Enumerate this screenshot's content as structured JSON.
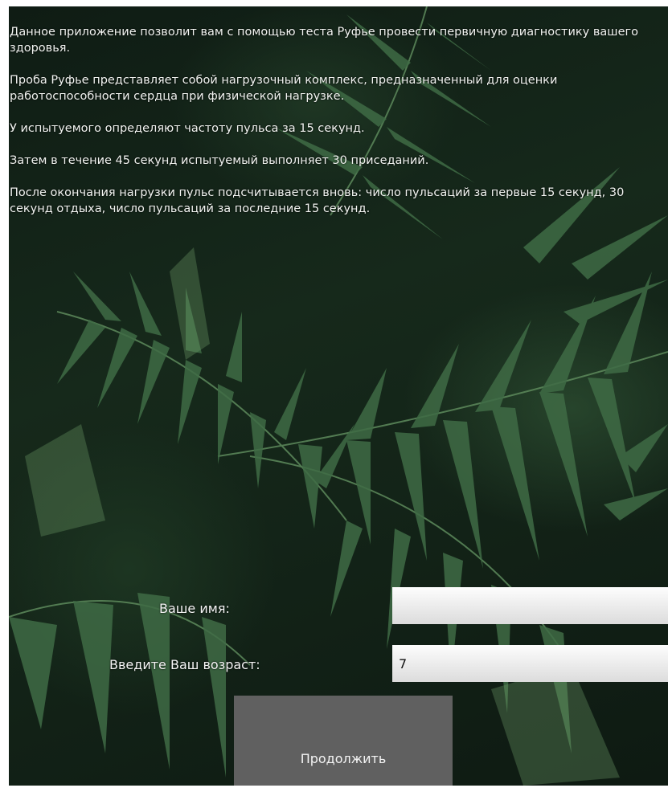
{
  "intro": {
    "paragraphs": [
      "Данное приложение позволит вам с помощью теста Руфье провести первичную диагностику вашего здоровья.",
      "Проба Руфье представляет собой нагрузочный комплекс, предназначенный для оценки работоспособности сердца при физической нагрузке.",
      "У испытуемого определяют частоту пульса за 15 секунд.",
      "Затем в течение 45 секунд испытуемый выполняет 30 приседаний.",
      "После окончания нагрузки пульс подсчитывается вновь: число пульсаций за первые 15 секунд, 30 секунд отдыха, число пульсаций за последние 15 секунд."
    ]
  },
  "form": {
    "name_label": "Ваше имя:",
    "name_value": "",
    "age_label": "Введите Ваш возраст:",
    "age_value": "7",
    "continue_label": "Продолжить"
  },
  "background": {
    "image": "palm-leaves",
    "base_color": "#13231a",
    "leaf_color": "#3f6b45"
  }
}
